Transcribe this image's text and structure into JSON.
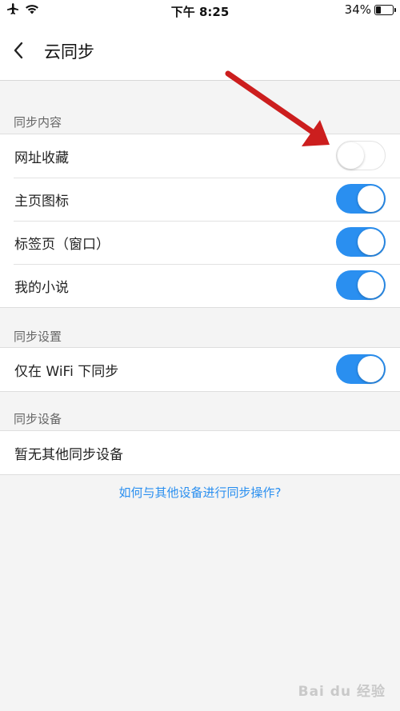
{
  "status_bar": {
    "time": "下午 8:25",
    "battery_percent": "34%",
    "battery_level": 0.34,
    "icons": [
      "airplane-icon",
      "wifi-icon",
      "battery-icon"
    ]
  },
  "nav": {
    "title": "云同步",
    "back_icon": "chevron-left-icon"
  },
  "sections": [
    {
      "header": "同步内容",
      "items": [
        {
          "label": "网址收藏",
          "toggle": "off"
        },
        {
          "label": "主页图标",
          "toggle": "on"
        },
        {
          "label": "标签页（窗口）",
          "toggle": "on"
        },
        {
          "label": "我的小说",
          "toggle": "on"
        }
      ]
    },
    {
      "header": "同步设置",
      "items": [
        {
          "label": "仅在 WiFi 下同步",
          "toggle": "on"
        }
      ]
    },
    {
      "header": "同步设备",
      "items": [
        {
          "label": "暂无其他同步设备"
        }
      ]
    }
  ],
  "help_link": "如何与其他设备进行同步操作?",
  "annotation": {
    "color": "#cc1e1e",
    "icon": "red-arrow-annotation"
  },
  "watermark": "Bai du 经验",
  "colors": {
    "accent": "#2a8ff0",
    "background": "#f4f4f4",
    "toggle_on": "#2a8ff0",
    "toggle_off": "#ffffff"
  }
}
